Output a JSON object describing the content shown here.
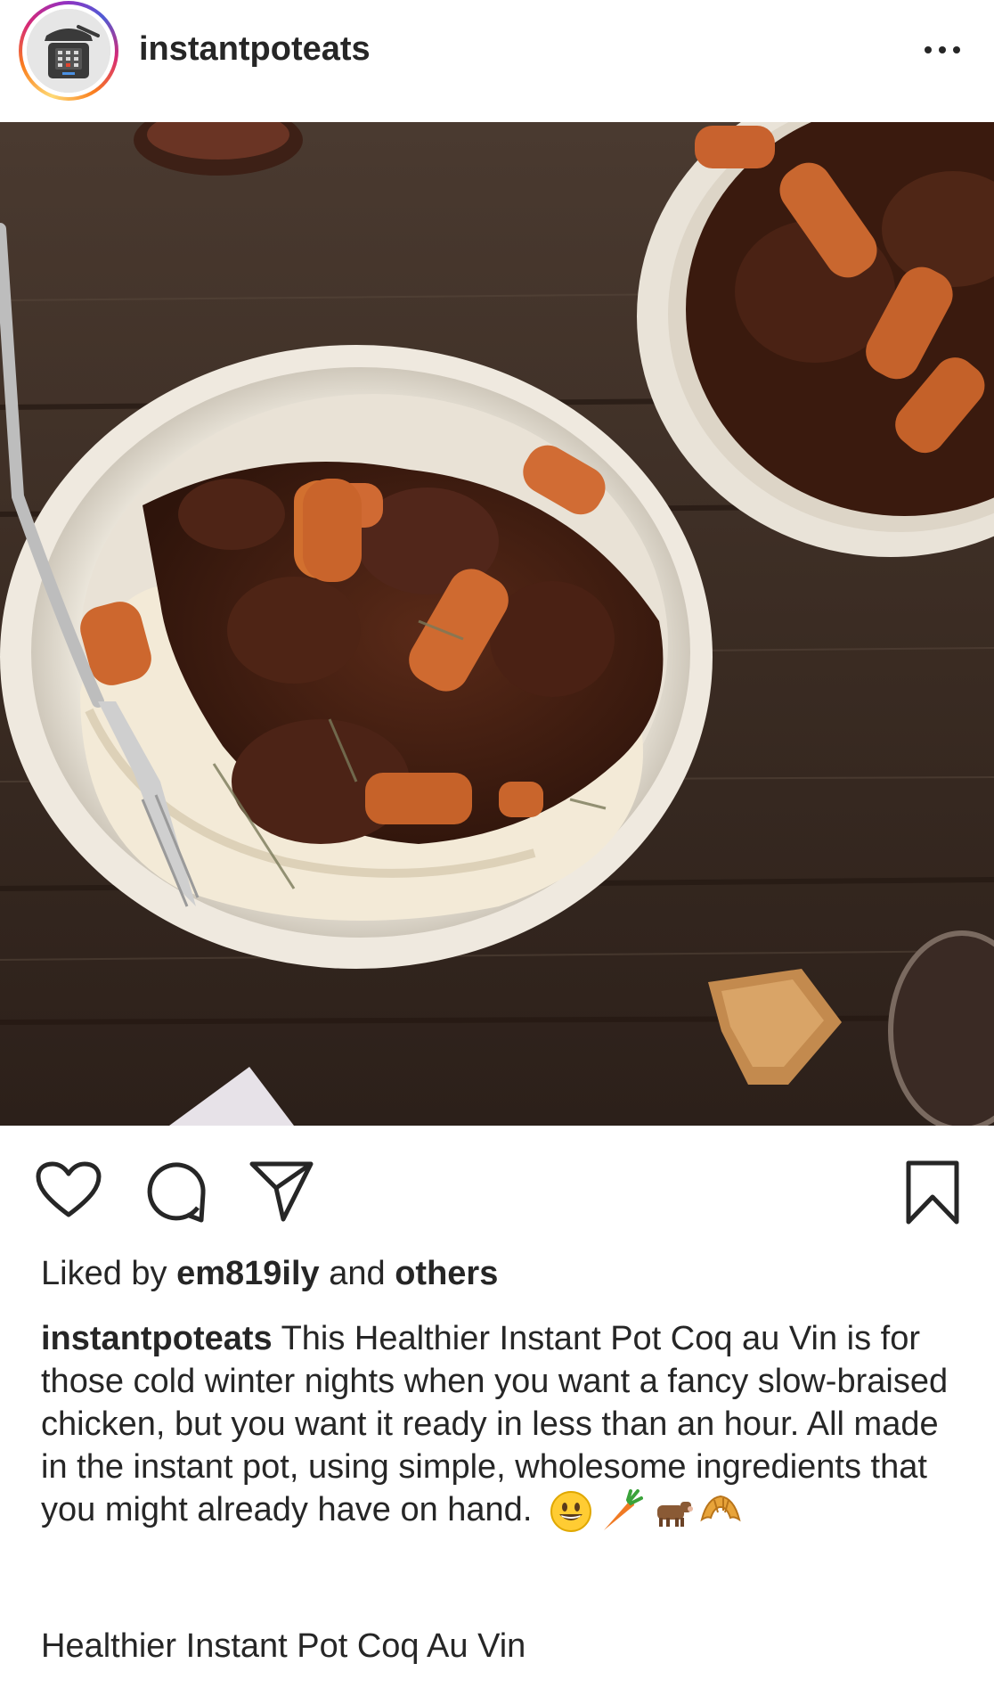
{
  "post": {
    "username": "instantpoteats",
    "more_icon": "more-horizontal-icon",
    "image_alt": "Coq au Vin with carrots over mashed potatoes in a white bowl on a rustic wooden table"
  },
  "actions": {
    "like_icon": "heart-icon",
    "comment_icon": "comment-icon",
    "share_icon": "send-icon",
    "save_icon": "bookmark-icon"
  },
  "likes": {
    "prefix": "Liked by",
    "user": "em819ily",
    "middle": "and",
    "others": "others"
  },
  "caption": {
    "username": "instantpoteats",
    "text": "This Healthier Instant Pot Coq au Vin is for those cold winter nights when you want a fancy slow-braised chicken, but you want it ready in less than an hour. All made in the instant pot, using simple, wholesome ingredients that you might already have on hand.",
    "emojis": [
      "grinning-face-emoji",
      "carrot-emoji",
      "cow-emoji",
      "croissant-emoji"
    ]
  },
  "recipe_title": "Healthier Instant Pot Coq Au Vin"
}
